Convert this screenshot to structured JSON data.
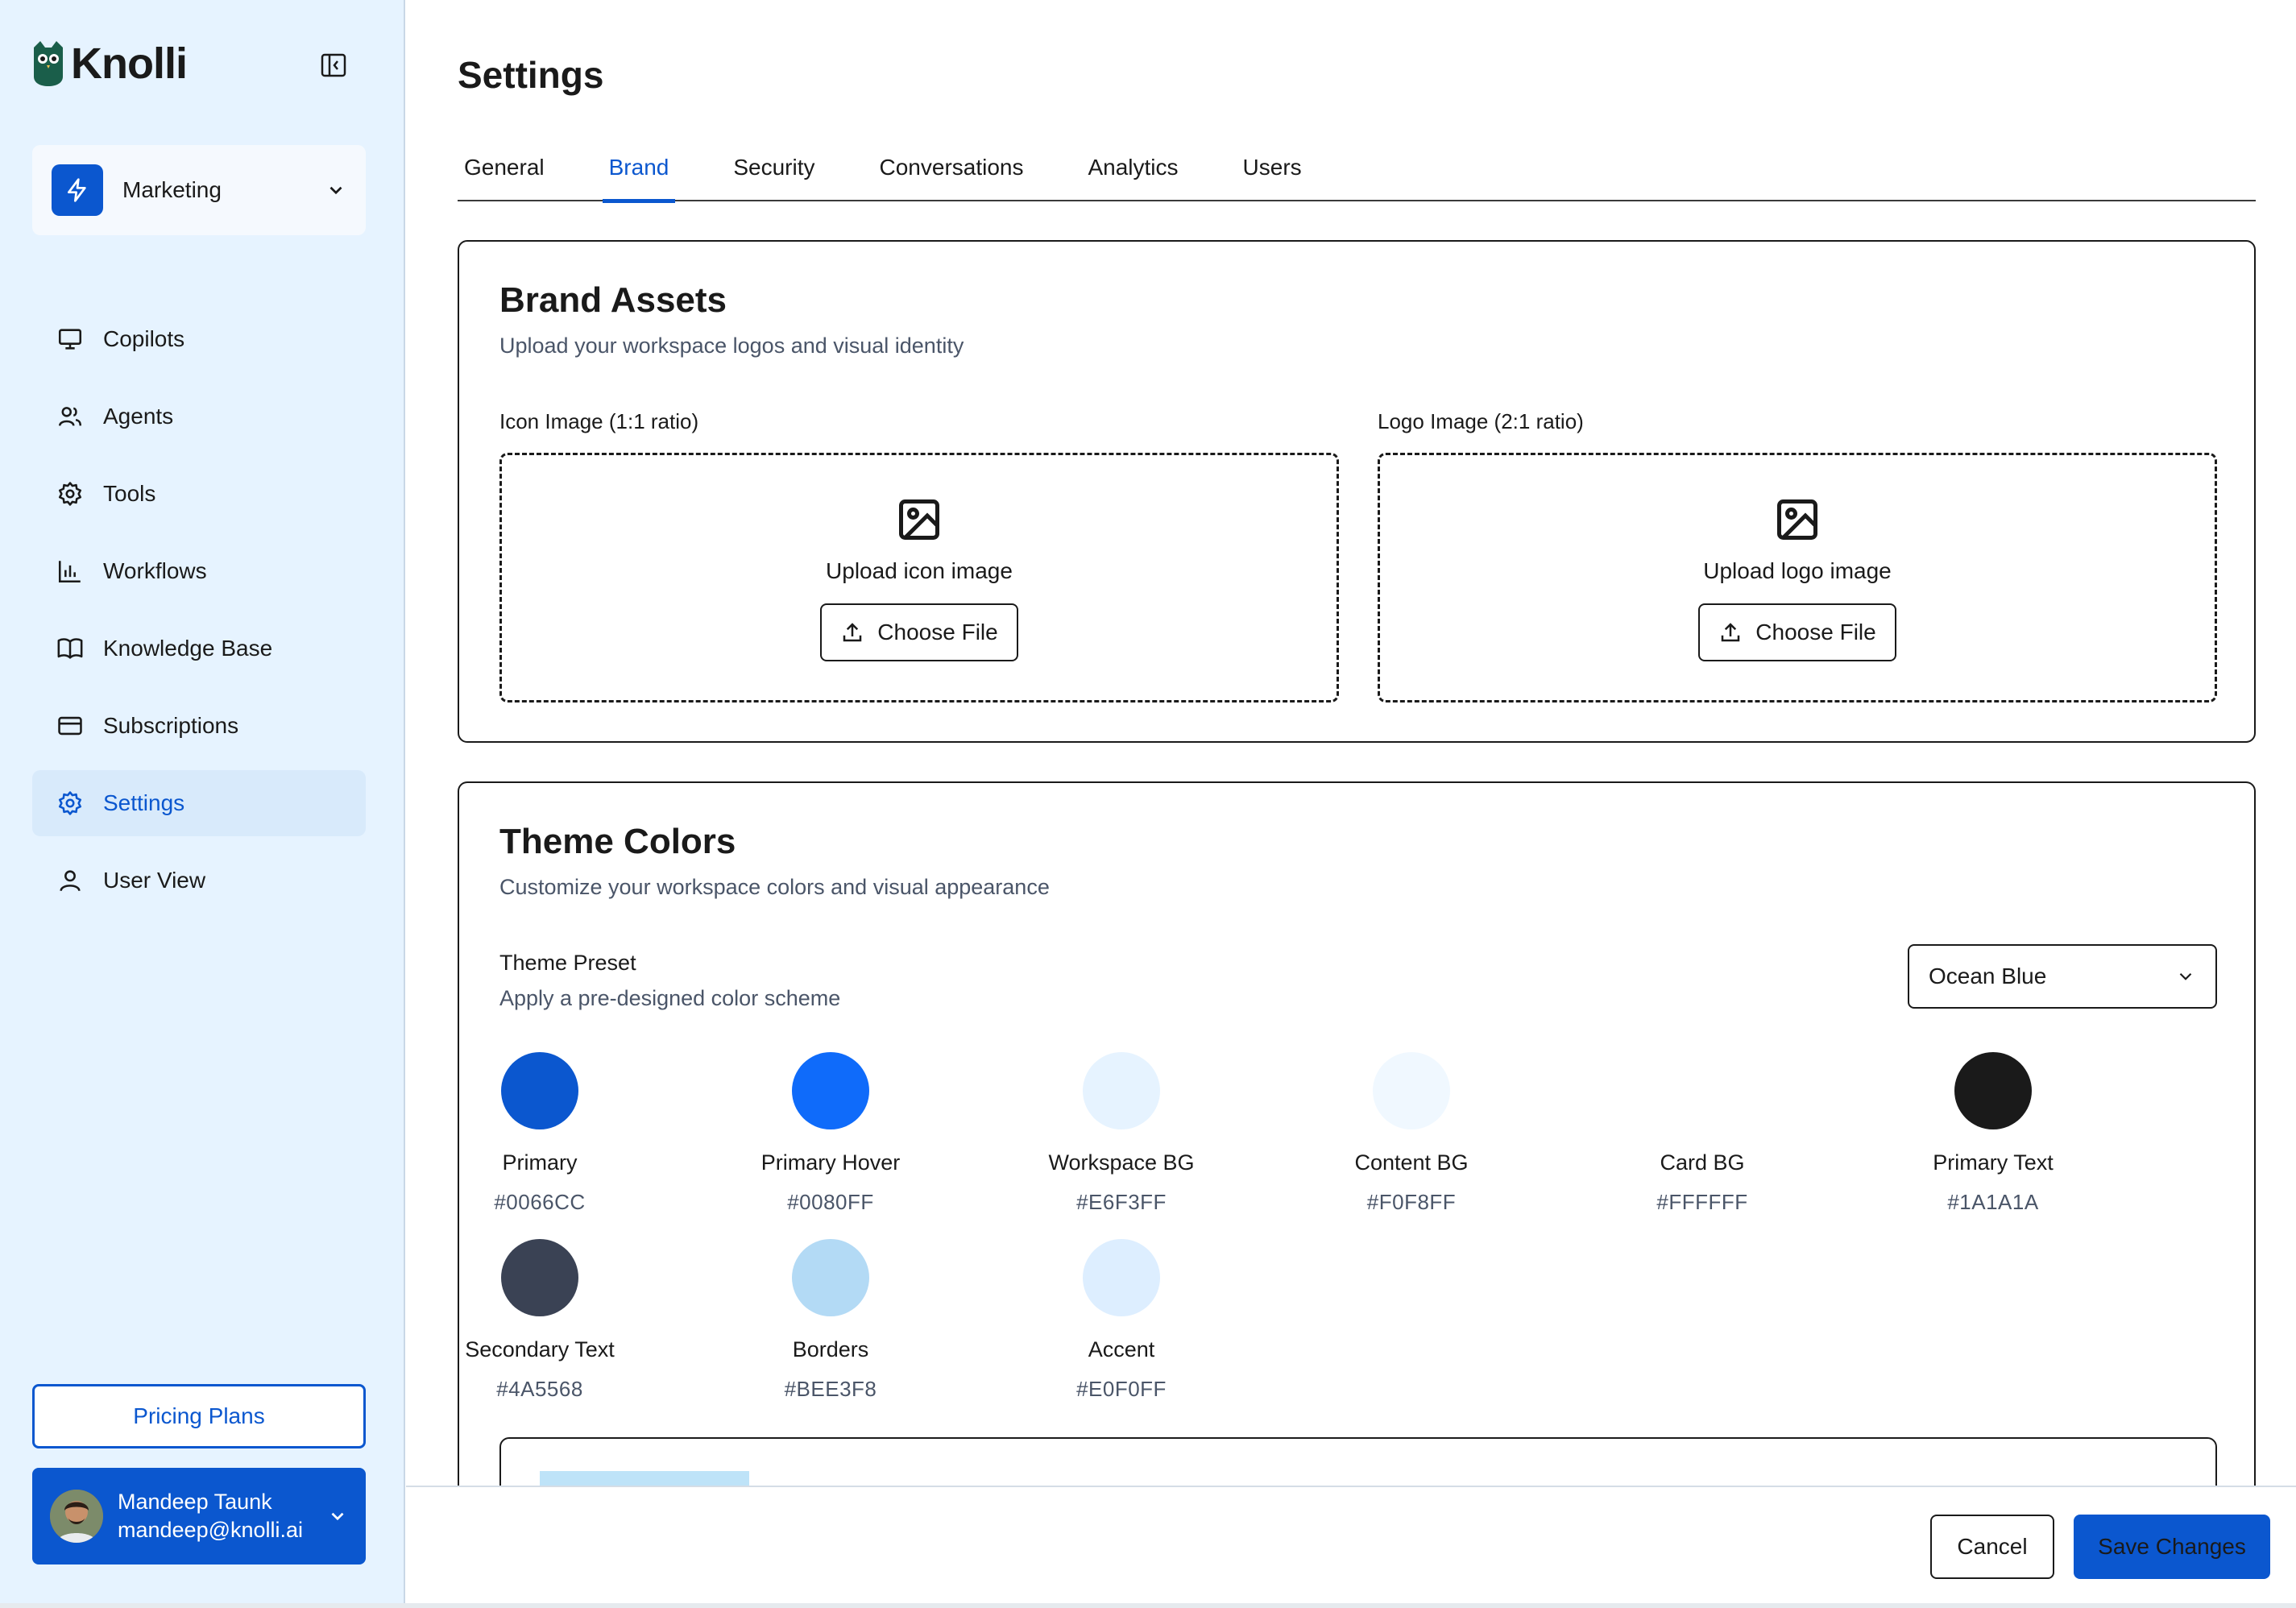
{
  "app": {
    "name": "Knolli"
  },
  "workspace": {
    "name": "Marketing"
  },
  "sidebar": {
    "items": [
      {
        "label": "Copilots",
        "icon": "monitor-icon"
      },
      {
        "label": "Agents",
        "icon": "users-icon"
      },
      {
        "label": "Tools",
        "icon": "gear-icon"
      },
      {
        "label": "Workflows",
        "icon": "bar-chart-icon"
      },
      {
        "label": "Knowledge Base",
        "icon": "book-icon"
      },
      {
        "label": "Subscriptions",
        "icon": "credit-card-icon"
      },
      {
        "label": "Settings",
        "icon": "gear-icon",
        "active": true
      },
      {
        "label": "User View",
        "icon": "user-icon"
      }
    ],
    "pricing_label": "Pricing Plans",
    "user": {
      "name": "Mandeep Taunk",
      "email": "mandeep@knolli.ai"
    }
  },
  "page": {
    "title": "Settings"
  },
  "tabs": [
    {
      "label": "General"
    },
    {
      "label": "Brand",
      "active": true
    },
    {
      "label": "Security"
    },
    {
      "label": "Conversations"
    },
    {
      "label": "Analytics"
    },
    {
      "label": "Users"
    }
  ],
  "brand_assets": {
    "title": "Brand Assets",
    "subtitle": "Upload your workspace logos and visual identity",
    "icon_upload": {
      "label": "Icon Image (1:1 ratio)",
      "prompt": "Upload icon image",
      "button": "Choose File"
    },
    "logo_upload": {
      "label": "Logo Image (2:1 ratio)",
      "prompt": "Upload logo image",
      "button": "Choose File"
    }
  },
  "theme_colors": {
    "title": "Theme Colors",
    "subtitle": "Customize your workspace colors and visual appearance",
    "preset_label": "Theme Preset",
    "preset_sub": "Apply a pre-designed color scheme",
    "preset_value": "Ocean Blue",
    "swatches": [
      {
        "name": "Primary",
        "hex": "#0066CC",
        "display": "#0B57CF"
      },
      {
        "name": "Primary Hover",
        "hex": "#0080FF",
        "display": "#0F6BFA"
      },
      {
        "name": "Workspace BG",
        "hex": "#E6F3FF",
        "display": "#E6F3FF"
      },
      {
        "name": "Content BG",
        "hex": "#F0F8FF",
        "display": "#F0F8FF"
      },
      {
        "name": "Card BG",
        "hex": "#FFFFFF",
        "display": "#FFFFFF"
      },
      {
        "name": "Primary Text",
        "hex": "#1A1A1A",
        "display": "#1A1A1A"
      },
      {
        "name": "Secondary Text",
        "hex": "#4A5568",
        "display": "#3A4254"
      },
      {
        "name": "Borders",
        "hex": "#BEE3F8",
        "display": "#B3DAF5"
      },
      {
        "name": "Accent",
        "hex": "#E0F0FF",
        "display": "#DDEEFF"
      }
    ]
  },
  "footer": {
    "cancel_label": "Cancel",
    "save_label": "Save Changes"
  },
  "colors": {
    "accent": "#0B57CF",
    "sidebar_bg": "#E6F3FF",
    "text": "#1A1A1A",
    "muted": "#4A5568"
  }
}
